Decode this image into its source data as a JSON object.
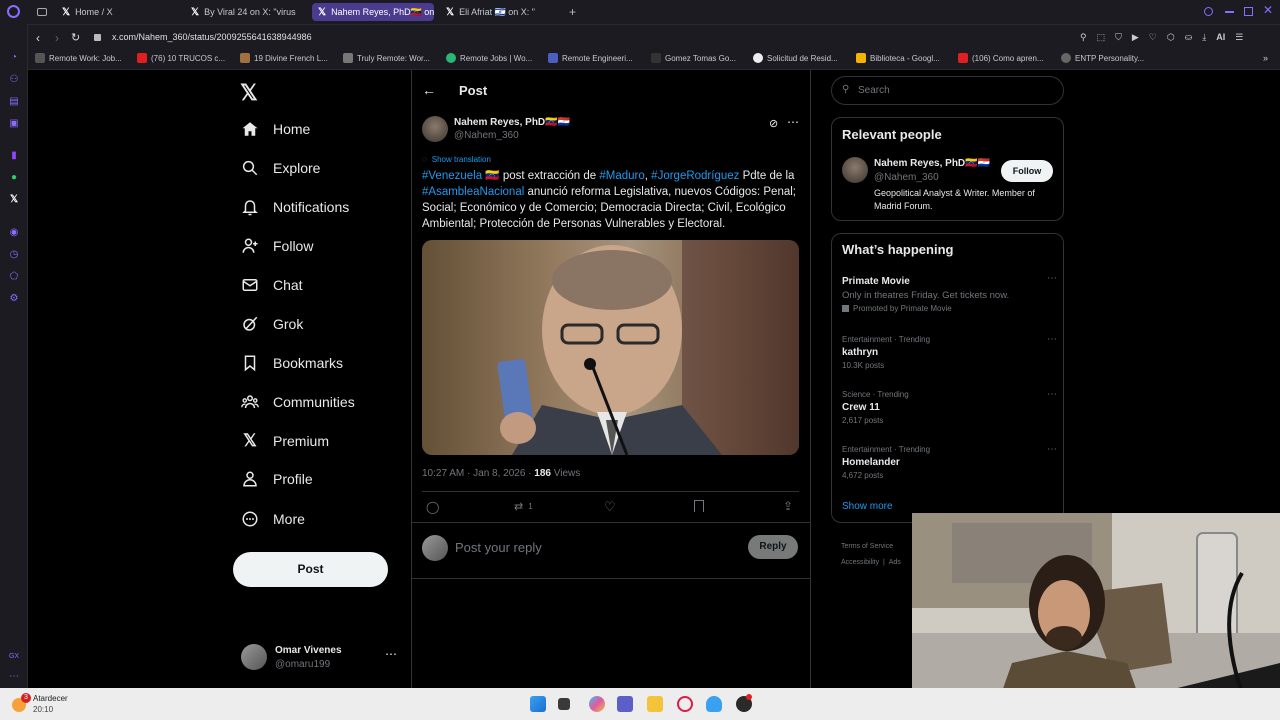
{
  "browser": {
    "tabs": [
      {
        "label": "Home / X"
      },
      {
        "label": "By Viral 24 on X: \"virus"
      },
      {
        "label": "Nahem Reyes, PhD🇻🇪 on"
      },
      {
        "label": "Eli Afriat 🇮🇱 on X: \""
      }
    ],
    "url": "x.com/Nahem_360/status/2009255641638944986",
    "bookmarks": [
      {
        "label": "Remote Work: Job..."
      },
      {
        "label": "(76) 10 TRUCOS c..."
      },
      {
        "label": "19 Divine French L..."
      },
      {
        "label": "Truly Remote: Wor..."
      },
      {
        "label": "Remote Jobs | Wo..."
      },
      {
        "label": "Remote Engineeri..."
      },
      {
        "label": "Gomez Tomas Go..."
      },
      {
        "label": "Solicitud de Resid..."
      },
      {
        "label": "Biblioteca - Googl..."
      },
      {
        "label": "(106) Como apren..."
      },
      {
        "label": "ENTP Personality..."
      }
    ],
    "ai_label": "AI",
    "side_bottom": "GX"
  },
  "nav": {
    "items": [
      {
        "label": "Home"
      },
      {
        "label": "Explore"
      },
      {
        "label": "Notifications"
      },
      {
        "label": "Follow"
      },
      {
        "label": "Chat"
      },
      {
        "label": "Grok"
      },
      {
        "label": "Bookmarks"
      },
      {
        "label": "Communities"
      },
      {
        "label": "Premium"
      },
      {
        "label": "Profile"
      },
      {
        "label": "More"
      }
    ],
    "post_button": "Post",
    "account": {
      "name": "Omar Vivenes",
      "handle": "@omaru199"
    }
  },
  "post": {
    "header": "Post",
    "author": {
      "name": "Nahem Reyes, PhD🇻🇪🇵🇾",
      "handle": "@Nahem_360"
    },
    "translate": "Show translation",
    "text": {
      "tag1": "#Venezuela",
      "flag": "🇻🇪",
      "t1": " post extracción de ",
      "tag2": "#Maduro",
      "t2": ", ",
      "tag3": "#JorgeRodríguez",
      "t3": " Pdte de la ",
      "tag4": "#AsambleaNacional",
      "t4": " anunció reforma Legislativa, nuevos Códigos: Penal; Social; Económico y de Comercio; Democracia Directa; Civil, Ecológico Ambiental; Protección de Personas Vulnerables y Electoral."
    },
    "time": "10:27 AM · Jan 8, 2026 · ",
    "views_count": "186",
    "views_label": " Views",
    "retweets": "1",
    "reply_placeholder": "Post your reply",
    "reply_button": "Reply"
  },
  "right": {
    "search_placeholder": "Search",
    "relevant": {
      "title": "Relevant people",
      "name": "Nahem Reyes, PhD🇻🇪🇵🇾",
      "handle": "@Nahem_360",
      "bio": "Geopolitical Analyst & Writer. Member of Madrid Forum.",
      "follow": "Follow"
    },
    "happening": {
      "title": "What’s happening",
      "promo": {
        "title": "Primate Movie",
        "desc": "Only in theatres Friday. Get tickets now.",
        "by": "Promoted by Primate Movie"
      },
      "trends": [
        {
          "context": "Entertainment · Trending",
          "name": "kathryn",
          "posts": "10.3K posts"
        },
        {
          "context": "Science · Trending",
          "name": "Crew 11",
          "posts": "2,617 posts"
        },
        {
          "context": "Entertainment · Trending",
          "name": "Homelander",
          "posts": "4,672 posts"
        }
      ],
      "show_more": "Show more"
    },
    "footer": {
      "terms": "Terms of Service",
      "accessibility": "Accessibility",
      "ads": "Ads"
    }
  },
  "taskbar": {
    "weather_name": "Atardecer",
    "time": "20:10",
    "badge": "3"
  },
  "colors": {
    "accent": "#1d9bf0",
    "tab_active": "#4a3b8f",
    "taskbar": "#ededed"
  }
}
